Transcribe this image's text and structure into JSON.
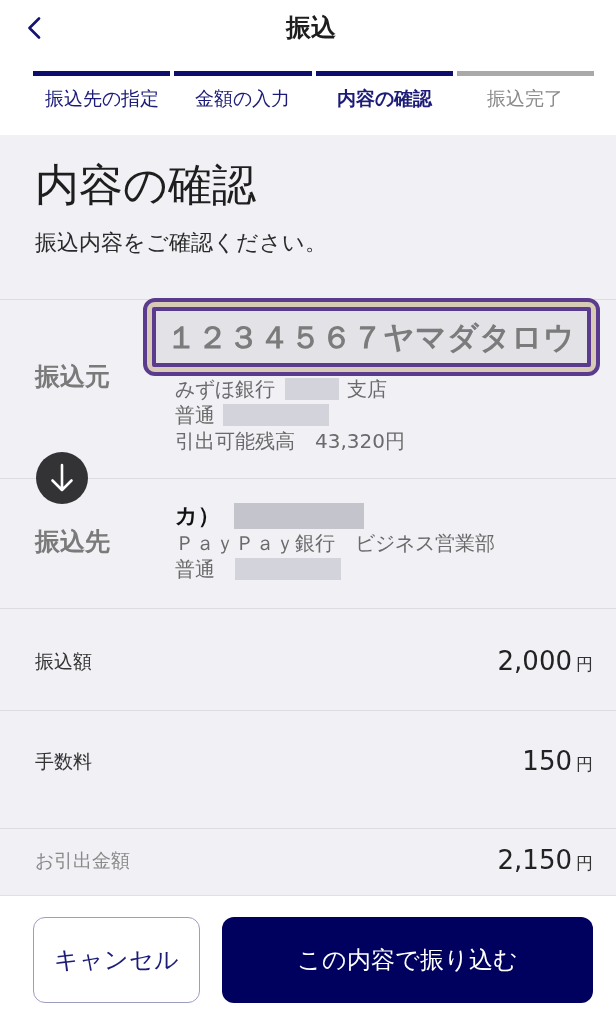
{
  "header": {
    "title": "振込"
  },
  "steps": [
    {
      "label": "振込先の指定",
      "reached": true,
      "selected": false
    },
    {
      "label": "金額の入力",
      "reached": true,
      "selected": false
    },
    {
      "label": "内容の確認",
      "reached": true,
      "selected": true
    },
    {
      "label": "振込完了",
      "reached": false,
      "selected": false
    }
  ],
  "page": {
    "heading": "内容の確認",
    "subtitle": "振込内容をご確認ください。"
  },
  "accounts": [
    {
      "label": "振込元",
      "highlighted": true,
      "name": [
        {
          "kind": "blurred",
          "text": "１２３４５６７ヤマダタロウ"
        }
      ],
      "lines": [
        [
          {
            "kind": "text",
            "text": "みずほ銀行"
          },
          {
            "kind": "redacted"
          },
          {
            "kind": "text",
            "text": "支店"
          }
        ],
        [
          {
            "kind": "text",
            "text": "普通"
          },
          {
            "kind": "redacted"
          }
        ],
        [
          {
            "kind": "text",
            "text": "引出可能残高　43,320円"
          }
        ]
      ]
    },
    {
      "label": "振込先",
      "highlighted": false,
      "name": [
        {
          "kind": "text",
          "text": "カ）"
        },
        {
          "kind": "redacted"
        }
      ],
      "lines": [
        [
          {
            "kind": "text",
            "text": "ＰａｙＰａｙ銀行　ビジネス営業部"
          }
        ],
        [
          {
            "kind": "text",
            "text": "普通"
          },
          {
            "kind": "redacted"
          }
        ]
      ]
    }
  ],
  "amounts": [
    {
      "label": "振込額",
      "amount": "2,000",
      "unit": "円",
      "muted": false
    },
    {
      "label": "手数料",
      "amount": "150",
      "unit": "円",
      "muted": false
    },
    {
      "label": "お引出金額",
      "amount": "2,150",
      "unit": "円",
      "muted": true
    }
  ],
  "buttons": [
    {
      "label": "キャンセル",
      "kind": "secondary"
    },
    {
      "label": "この内容で振り込む",
      "kind": "primary"
    }
  ]
}
